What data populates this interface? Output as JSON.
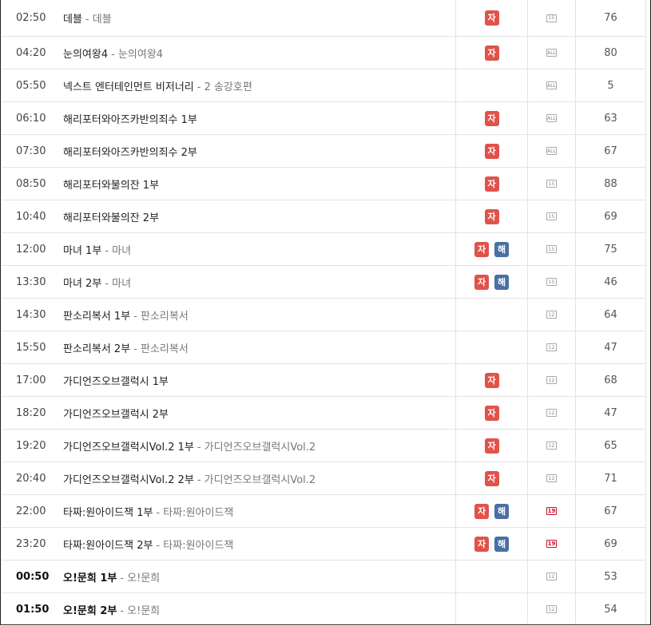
{
  "schedule": [
    {
      "time": "02:50",
      "title": "데블",
      "sub": "- 데블",
      "badges": [
        "자"
      ],
      "rating": "15",
      "score": "76",
      "bold": false
    },
    {
      "time": "04:20",
      "title": "눈의여왕4",
      "sub": "- 눈의여왕4",
      "badges": [
        "자"
      ],
      "rating": "all",
      "score": "80",
      "bold": false
    },
    {
      "time": "05:50",
      "title": "넥스트 엔터테인먼트 비저너리",
      "sub": "- 2 송강호편",
      "badges": [],
      "rating": "all",
      "score": "5",
      "bold": false
    },
    {
      "time": "06:10",
      "title": "해리포터와아즈카반의죄수 1부",
      "sub": "",
      "badges": [
        "자"
      ],
      "rating": "all",
      "score": "63",
      "bold": false
    },
    {
      "time": "07:30",
      "title": "해리포터와아즈카반의죄수 2부",
      "sub": "",
      "badges": [
        "자"
      ],
      "rating": "all",
      "score": "67",
      "bold": false
    },
    {
      "time": "08:50",
      "title": "해리포터와불의잔 1부",
      "sub": "",
      "badges": [
        "자"
      ],
      "rating": "15",
      "score": "88",
      "bold": false
    },
    {
      "time": "10:40",
      "title": "해리포터와불의잔 2부",
      "sub": "",
      "badges": [
        "자"
      ],
      "rating": "15",
      "score": "69",
      "bold": false
    },
    {
      "time": "12:00",
      "title": "마녀 1부",
      "sub": "- 마녀",
      "badges": [
        "자",
        "해"
      ],
      "rating": "15",
      "score": "75",
      "bold": false
    },
    {
      "time": "13:30",
      "title": "마녀 2부",
      "sub": "- 마녀",
      "badges": [
        "자",
        "해"
      ],
      "rating": "15",
      "score": "46",
      "bold": false
    },
    {
      "time": "14:30",
      "title": "판소리복서 1부",
      "sub": "- 판소리복서",
      "badges": [],
      "rating": "12",
      "score": "64",
      "bold": false
    },
    {
      "time": "15:50",
      "title": "판소리복서 2부",
      "sub": "- 판소리복서",
      "badges": [],
      "rating": "12",
      "score": "47",
      "bold": false
    },
    {
      "time": "17:00",
      "title": "가디언즈오브갤럭시 1부",
      "sub": "",
      "badges": [
        "자"
      ],
      "rating": "12",
      "score": "68",
      "bold": false
    },
    {
      "time": "18:20",
      "title": "가디언즈오브갤럭시 2부",
      "sub": "",
      "badges": [
        "자"
      ],
      "rating": "12",
      "score": "47",
      "bold": false
    },
    {
      "time": "19:20",
      "title": "가디언즈오브갤럭시Vol.2 1부",
      "sub": "- 가디언즈오브갤럭시Vol.2",
      "badges": [
        "자"
      ],
      "rating": "12",
      "score": "65",
      "bold": false
    },
    {
      "time": "20:40",
      "title": "가디언즈오브갤럭시Vol.2 2부",
      "sub": "- 가디언즈오브갤럭시Vol.2",
      "badges": [
        "자"
      ],
      "rating": "12",
      "score": "71",
      "bold": false
    },
    {
      "time": "22:00",
      "title": "타짜:원아이드잭 1부",
      "sub": "- 타짜:원아이드잭",
      "badges": [
        "자",
        "해"
      ],
      "rating": "19",
      "score": "67",
      "bold": false
    },
    {
      "time": "23:20",
      "title": "타짜:원아이드잭 2부",
      "sub": "- 타짜:원아이드잭",
      "badges": [
        "자",
        "해"
      ],
      "rating": "19",
      "score": "69",
      "bold": false
    },
    {
      "time": "00:50",
      "title": "오!문희 1부",
      "sub": "- 오!문희",
      "badges": [],
      "rating": "12",
      "score": "53",
      "bold": true
    },
    {
      "time": "01:50",
      "title": "오!문희 2부",
      "sub": "- 오!문희",
      "badges": [],
      "rating": "12",
      "score": "54",
      "bold": true
    }
  ],
  "rating_labels": {
    "all": "ALL",
    "12": "12",
    "15": "15",
    "19": "19"
  },
  "colors": {
    "subtitle_badge": "#e0524a",
    "commentary_badge": "#4a6fa5",
    "rating_19": "#c8102e"
  }
}
